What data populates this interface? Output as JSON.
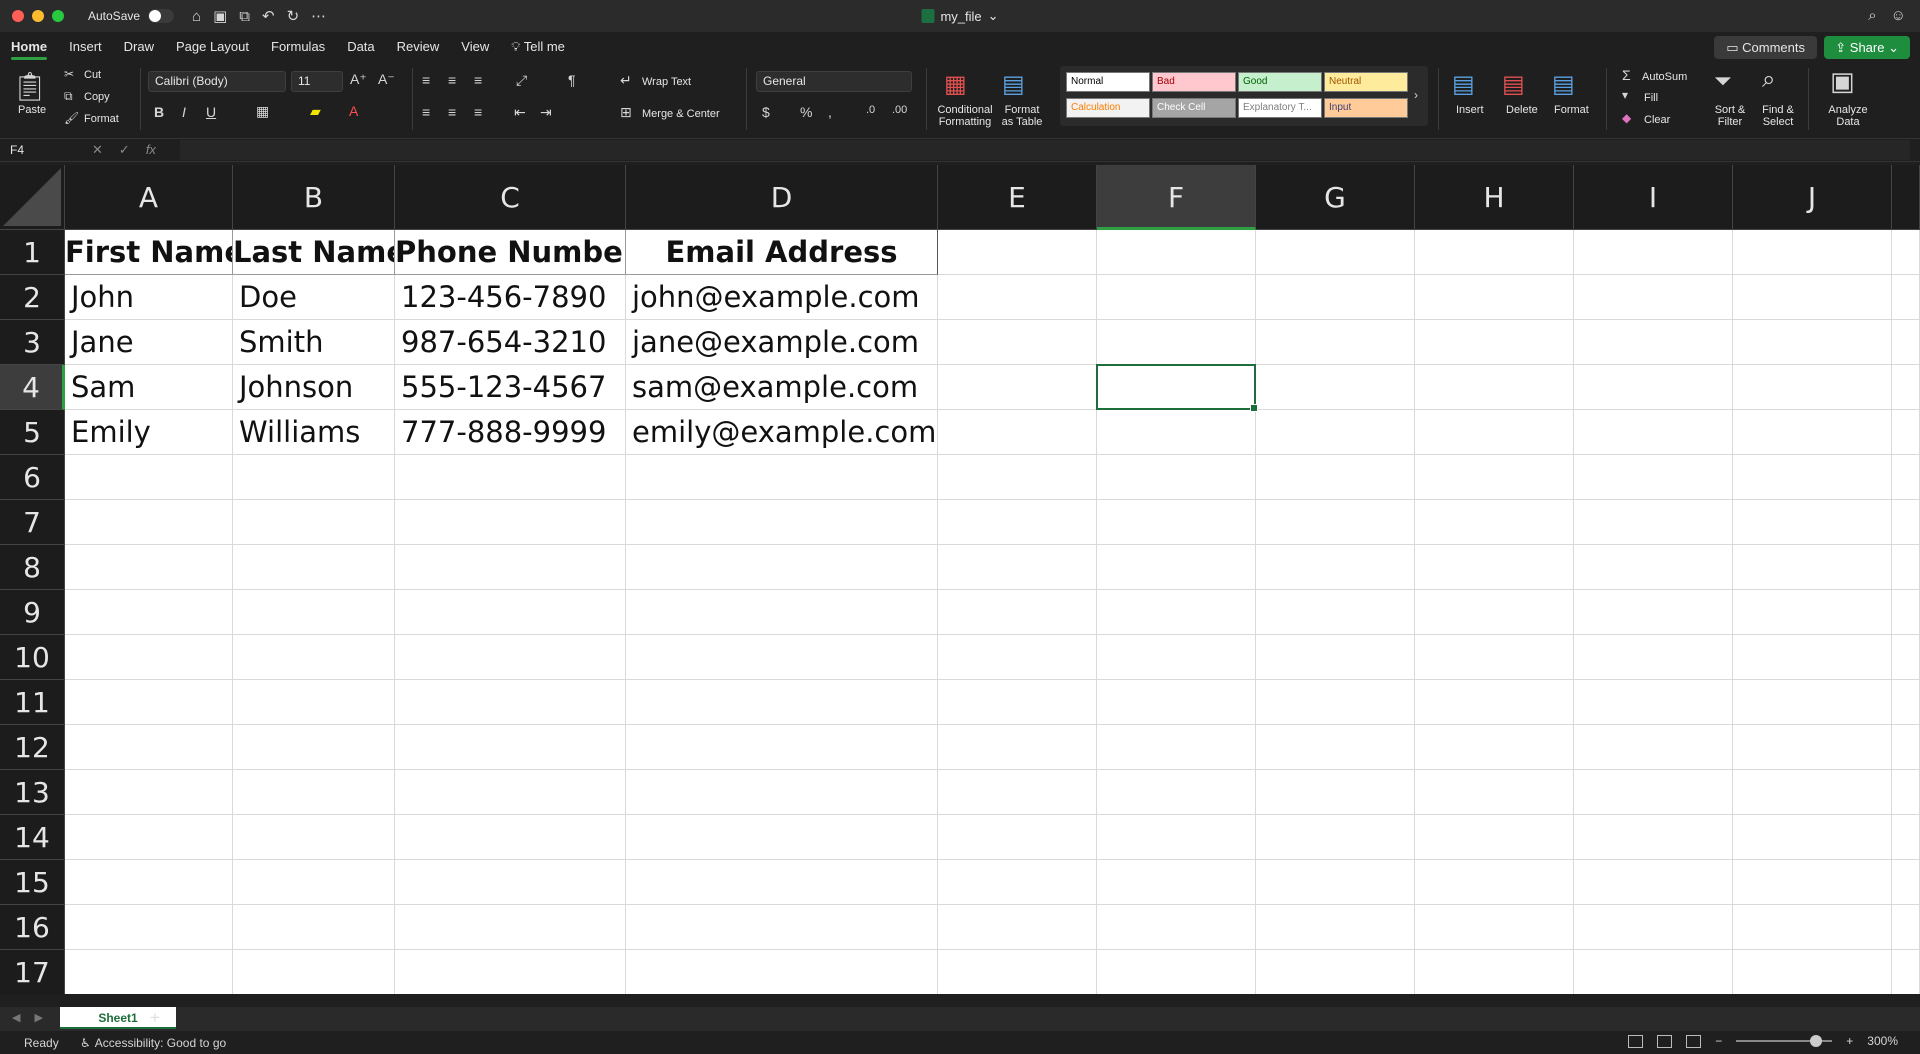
{
  "titlebar": {
    "autosave_label": "AutoSave",
    "doc_title": "my_file",
    "colors": {
      "close": "#ff5f57",
      "minimize": "#febc2e",
      "zoom": "#28c840"
    }
  },
  "ribbon_tabs": [
    "Home",
    "Insert",
    "Draw",
    "Page Layout",
    "Formulas",
    "Data",
    "Review",
    "View",
    "Tell me"
  ],
  "active_tab": "Home",
  "buttons": {
    "comments": "Comments",
    "share": "Share"
  },
  "clipboard": {
    "paste": "Paste",
    "cut": "Cut",
    "copy": "Copy",
    "format": "Format"
  },
  "font": {
    "name": "Calibri (Body)",
    "size": "11"
  },
  "alignment": {
    "wrap_text": "Wrap Text",
    "merge_center": "Merge & Center"
  },
  "number": {
    "format": "General"
  },
  "styles_group": {
    "conditional_formatting": "Conditional\nFormatting",
    "format_as_table": "Format\nas Table",
    "styles": [
      {
        "label": "Normal",
        "bg": "#ffffff",
        "fg": "#000000"
      },
      {
        "label": "Bad",
        "bg": "#ffc7ce",
        "fg": "#9c0006"
      },
      {
        "label": "Good",
        "bg": "#c6efce",
        "fg": "#006100"
      },
      {
        "label": "Neutral",
        "bg": "#ffeb9c",
        "fg": "#9c5700"
      },
      {
        "label": "Calculation",
        "bg": "#f2f2f2",
        "fg": "#fa7d00"
      },
      {
        "label": "Check Cell",
        "bg": "#a5a5a5",
        "fg": "#ffffff"
      },
      {
        "label": "Explanatory T...",
        "bg": "#ffffff",
        "fg": "#7f7f7f"
      },
      {
        "label": "Input",
        "bg": "#ffcc99",
        "fg": "#3f3f76"
      }
    ]
  },
  "cells_group": {
    "insert": "Insert",
    "delete": "Delete",
    "format": "Format"
  },
  "editing": {
    "autosum": "AutoSum",
    "fill": "Fill",
    "clear": "Clear",
    "sort_filter": "Sort &\nFilter",
    "find_select": "Find &\nSelect",
    "analyze": "Analyze\nData"
  },
  "formula_bar": {
    "name_box": "F4",
    "fx": "fx",
    "value": ""
  },
  "sheet": {
    "columns": [
      "A",
      "B",
      "C",
      "D",
      "E",
      "F",
      "G",
      "H",
      "I",
      "J"
    ],
    "rows": [
      "1",
      "2",
      "3",
      "4",
      "5",
      "6",
      "7",
      "8",
      "9",
      "10",
      "11",
      "12",
      "13",
      "14",
      "15",
      "16",
      "17"
    ],
    "selected_column": "F",
    "selected_row": "4",
    "header_row": [
      "First Name",
      "Last Name",
      "Phone Number",
      "Email Address"
    ],
    "data_rows": [
      [
        "John",
        "Doe",
        "123-456-7890",
        "john@example.com"
      ],
      [
        "Jane",
        "Smith",
        "987-654-3210",
        "jane@example.com"
      ],
      [
        "Sam",
        "Johnson",
        "555-123-4567",
        "sam@example.com"
      ],
      [
        "Emily",
        "Williams",
        "777-888-9999",
        "emily@example.com"
      ]
    ]
  },
  "sheet_tabs": {
    "active": "Sheet1"
  },
  "status": {
    "ready": "Ready",
    "accessibility": "Accessibility: Good to go",
    "zoom": "300%",
    "zoom_level": 3.0
  },
  "accent_color": "#1e6e3c"
}
